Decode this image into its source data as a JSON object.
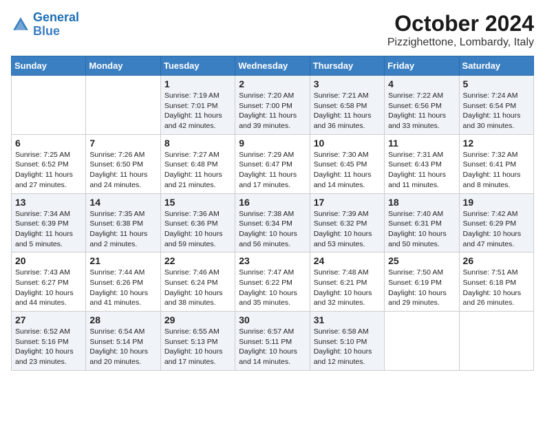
{
  "logo": {
    "line1": "General",
    "line2": "Blue"
  },
  "title": "October 2024",
  "location": "Pizzighettone, Lombardy, Italy",
  "days_of_week": [
    "Sunday",
    "Monday",
    "Tuesday",
    "Wednesday",
    "Thursday",
    "Friday",
    "Saturday"
  ],
  "weeks": [
    [
      {
        "day": "",
        "sunrise": "",
        "sunset": "",
        "daylight": ""
      },
      {
        "day": "",
        "sunrise": "",
        "sunset": "",
        "daylight": ""
      },
      {
        "day": "1",
        "sunrise": "Sunrise: 7:19 AM",
        "sunset": "Sunset: 7:01 PM",
        "daylight": "Daylight: 11 hours and 42 minutes."
      },
      {
        "day": "2",
        "sunrise": "Sunrise: 7:20 AM",
        "sunset": "Sunset: 7:00 PM",
        "daylight": "Daylight: 11 hours and 39 minutes."
      },
      {
        "day": "3",
        "sunrise": "Sunrise: 7:21 AM",
        "sunset": "Sunset: 6:58 PM",
        "daylight": "Daylight: 11 hours and 36 minutes."
      },
      {
        "day": "4",
        "sunrise": "Sunrise: 7:22 AM",
        "sunset": "Sunset: 6:56 PM",
        "daylight": "Daylight: 11 hours and 33 minutes."
      },
      {
        "day": "5",
        "sunrise": "Sunrise: 7:24 AM",
        "sunset": "Sunset: 6:54 PM",
        "daylight": "Daylight: 11 hours and 30 minutes."
      }
    ],
    [
      {
        "day": "6",
        "sunrise": "Sunrise: 7:25 AM",
        "sunset": "Sunset: 6:52 PM",
        "daylight": "Daylight: 11 hours and 27 minutes."
      },
      {
        "day": "7",
        "sunrise": "Sunrise: 7:26 AM",
        "sunset": "Sunset: 6:50 PM",
        "daylight": "Daylight: 11 hours and 24 minutes."
      },
      {
        "day": "8",
        "sunrise": "Sunrise: 7:27 AM",
        "sunset": "Sunset: 6:48 PM",
        "daylight": "Daylight: 11 hours and 21 minutes."
      },
      {
        "day": "9",
        "sunrise": "Sunrise: 7:29 AM",
        "sunset": "Sunset: 6:47 PM",
        "daylight": "Daylight: 11 hours and 17 minutes."
      },
      {
        "day": "10",
        "sunrise": "Sunrise: 7:30 AM",
        "sunset": "Sunset: 6:45 PM",
        "daylight": "Daylight: 11 hours and 14 minutes."
      },
      {
        "day": "11",
        "sunrise": "Sunrise: 7:31 AM",
        "sunset": "Sunset: 6:43 PM",
        "daylight": "Daylight: 11 hours and 11 minutes."
      },
      {
        "day": "12",
        "sunrise": "Sunrise: 7:32 AM",
        "sunset": "Sunset: 6:41 PM",
        "daylight": "Daylight: 11 hours and 8 minutes."
      }
    ],
    [
      {
        "day": "13",
        "sunrise": "Sunrise: 7:34 AM",
        "sunset": "Sunset: 6:39 PM",
        "daylight": "Daylight: 11 hours and 5 minutes."
      },
      {
        "day": "14",
        "sunrise": "Sunrise: 7:35 AM",
        "sunset": "Sunset: 6:38 PM",
        "daylight": "Daylight: 11 hours and 2 minutes."
      },
      {
        "day": "15",
        "sunrise": "Sunrise: 7:36 AM",
        "sunset": "Sunset: 6:36 PM",
        "daylight": "Daylight: 10 hours and 59 minutes."
      },
      {
        "day": "16",
        "sunrise": "Sunrise: 7:38 AM",
        "sunset": "Sunset: 6:34 PM",
        "daylight": "Daylight: 10 hours and 56 minutes."
      },
      {
        "day": "17",
        "sunrise": "Sunrise: 7:39 AM",
        "sunset": "Sunset: 6:32 PM",
        "daylight": "Daylight: 10 hours and 53 minutes."
      },
      {
        "day": "18",
        "sunrise": "Sunrise: 7:40 AM",
        "sunset": "Sunset: 6:31 PM",
        "daylight": "Daylight: 10 hours and 50 minutes."
      },
      {
        "day": "19",
        "sunrise": "Sunrise: 7:42 AM",
        "sunset": "Sunset: 6:29 PM",
        "daylight": "Daylight: 10 hours and 47 minutes."
      }
    ],
    [
      {
        "day": "20",
        "sunrise": "Sunrise: 7:43 AM",
        "sunset": "Sunset: 6:27 PM",
        "daylight": "Daylight: 10 hours and 44 minutes."
      },
      {
        "day": "21",
        "sunrise": "Sunrise: 7:44 AM",
        "sunset": "Sunset: 6:26 PM",
        "daylight": "Daylight: 10 hours and 41 minutes."
      },
      {
        "day": "22",
        "sunrise": "Sunrise: 7:46 AM",
        "sunset": "Sunset: 6:24 PM",
        "daylight": "Daylight: 10 hours and 38 minutes."
      },
      {
        "day": "23",
        "sunrise": "Sunrise: 7:47 AM",
        "sunset": "Sunset: 6:22 PM",
        "daylight": "Daylight: 10 hours and 35 minutes."
      },
      {
        "day": "24",
        "sunrise": "Sunrise: 7:48 AM",
        "sunset": "Sunset: 6:21 PM",
        "daylight": "Daylight: 10 hours and 32 minutes."
      },
      {
        "day": "25",
        "sunrise": "Sunrise: 7:50 AM",
        "sunset": "Sunset: 6:19 PM",
        "daylight": "Daylight: 10 hours and 29 minutes."
      },
      {
        "day": "26",
        "sunrise": "Sunrise: 7:51 AM",
        "sunset": "Sunset: 6:18 PM",
        "daylight": "Daylight: 10 hours and 26 minutes."
      }
    ],
    [
      {
        "day": "27",
        "sunrise": "Sunrise: 6:52 AM",
        "sunset": "Sunset: 5:16 PM",
        "daylight": "Daylight: 10 hours and 23 minutes."
      },
      {
        "day": "28",
        "sunrise": "Sunrise: 6:54 AM",
        "sunset": "Sunset: 5:14 PM",
        "daylight": "Daylight: 10 hours and 20 minutes."
      },
      {
        "day": "29",
        "sunrise": "Sunrise: 6:55 AM",
        "sunset": "Sunset: 5:13 PM",
        "daylight": "Daylight: 10 hours and 17 minutes."
      },
      {
        "day": "30",
        "sunrise": "Sunrise: 6:57 AM",
        "sunset": "Sunset: 5:11 PM",
        "daylight": "Daylight: 10 hours and 14 minutes."
      },
      {
        "day": "31",
        "sunrise": "Sunrise: 6:58 AM",
        "sunset": "Sunset: 5:10 PM",
        "daylight": "Daylight: 10 hours and 12 minutes."
      },
      {
        "day": "",
        "sunrise": "",
        "sunset": "",
        "daylight": ""
      },
      {
        "day": "",
        "sunrise": "",
        "sunset": "",
        "daylight": ""
      }
    ]
  ]
}
